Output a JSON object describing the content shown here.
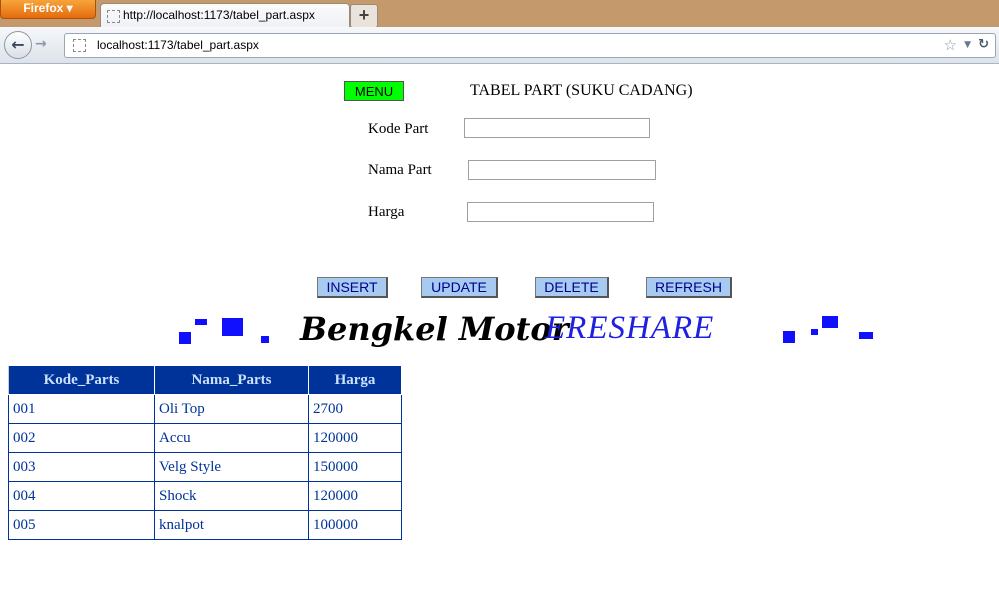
{
  "browser": {
    "menu_label": "Firefox",
    "tab_title": "http://localhost:1173/tabel_part.aspx",
    "new_tab": "+",
    "url": "localhost:1173/tabel_part.aspx"
  },
  "page": {
    "menu_button": "MENU",
    "title": "TABEL PART (SUKU CADANG)",
    "form": {
      "kode_label": "Kode Part",
      "kode_value": "",
      "nama_label": "Nama Part",
      "nama_value": "",
      "harga_label": "Harga",
      "harga_value": ""
    },
    "buttons": {
      "insert": "INSERT",
      "update": "UPDATE",
      "delete": "DELETE",
      "refresh": "REFRESH"
    },
    "banner": {
      "text1": "Bengkel Motor",
      "text2": "ERESHARE"
    },
    "table": {
      "headers": [
        "Kode_Parts",
        "Nama_Parts",
        "Harga"
      ],
      "rows": [
        [
          "001",
          "Oli Top",
          "2700"
        ],
        [
          "002",
          "Accu",
          "120000"
        ],
        [
          "003",
          "Velg Style",
          "150000"
        ],
        [
          "004",
          "Shock",
          "120000"
        ],
        [
          "005",
          "knalpot",
          "100000"
        ]
      ]
    }
  },
  "colors": {
    "menu_button": "#00ff00",
    "action_button": "#a6caf0",
    "table_header": "#003399",
    "banner_blue": "#1010ff"
  }
}
